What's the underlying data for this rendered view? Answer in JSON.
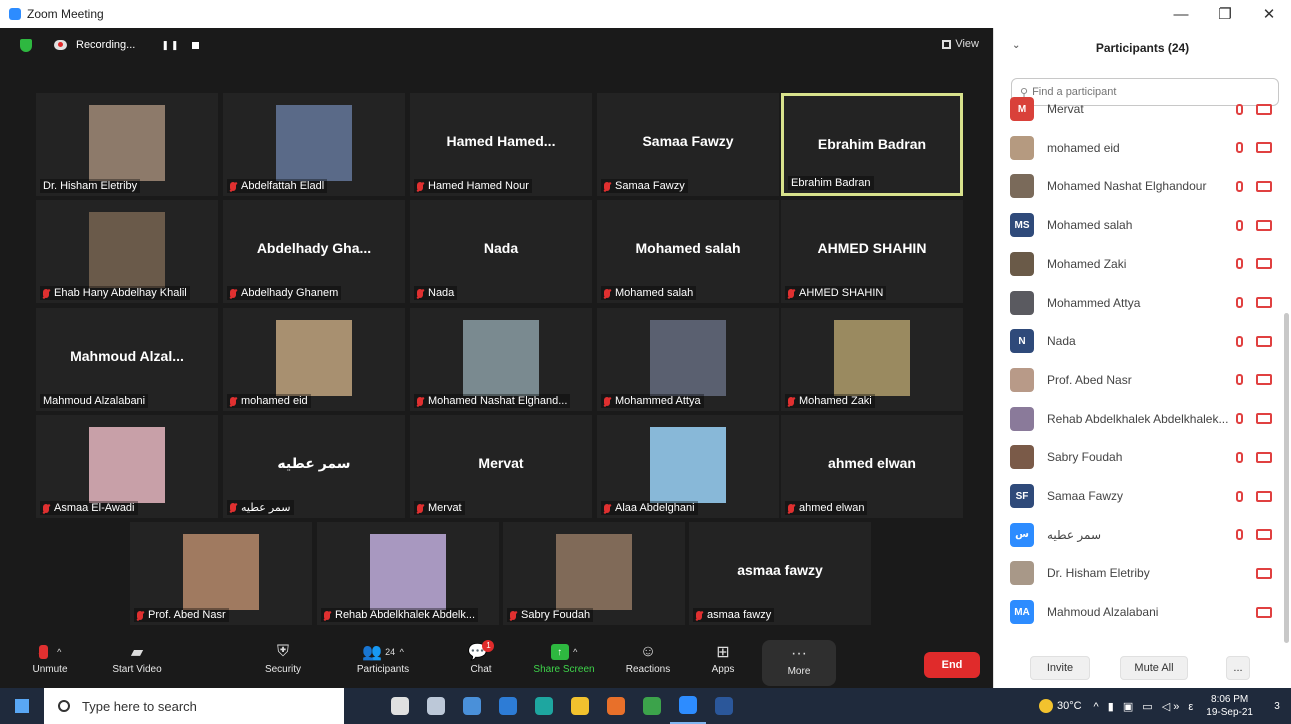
{
  "window": {
    "title": "Zoom Meeting",
    "min": "—",
    "max": "❐",
    "close": "✕"
  },
  "topbar": {
    "recording": "Recording...",
    "pause": "❚❚",
    "view": "View"
  },
  "gallery": [
    {
      "label": "Dr. Hisham Eletriby",
      "big": "",
      "photo": "#8d7a6a",
      "muted": false,
      "active": false
    },
    {
      "label": "Abdelfattah Eladl",
      "big": "",
      "photo": "#5a6a88",
      "muted": true,
      "active": false
    },
    {
      "label": "Hamed Hamed Nour",
      "big": "Hamed  Hamed...",
      "photo": "",
      "muted": true,
      "active": false
    },
    {
      "label": "Samaa Fawzy",
      "big": "Samaa Fawzy",
      "photo": "",
      "muted": true,
      "active": false
    },
    {
      "label": "Ebrahim Badran",
      "big": "Ebrahim Badran",
      "photo": "",
      "muted": false,
      "active": true
    },
    {
      "label": "Ehab Hany Abdelhay Khalil",
      "big": "",
      "photo": "#6a5a4a",
      "muted": true,
      "active": false
    },
    {
      "label": "Abdelhady Ghanem",
      "big": "Abdelhady  Gha...",
      "photo": "",
      "muted": true,
      "active": false
    },
    {
      "label": "Nada",
      "big": "Nada",
      "photo": "",
      "muted": true,
      "active": false
    },
    {
      "label": "Mohamed salah",
      "big": "Mohamed salah",
      "photo": "",
      "muted": true,
      "active": false
    },
    {
      "label": "AHMED SHAHIN",
      "big": "AHMED SHAHIN",
      "photo": "",
      "muted": true,
      "active": false
    },
    {
      "label": "Mahmoud Alzalabani",
      "big": "Mahmoud  Alzal...",
      "photo": "",
      "muted": false,
      "active": false
    },
    {
      "label": "mohamed eid",
      "big": "",
      "photo": "#a89070",
      "muted": true,
      "active": false
    },
    {
      "label": "Mohamed Nashat Elghand...",
      "big": "",
      "photo": "#7a8a90",
      "muted": true,
      "active": false
    },
    {
      "label": "Mohammed Attya",
      "big": "",
      "photo": "#5a6070",
      "muted": true,
      "active": false
    },
    {
      "label": "Mohamed Zaki",
      "big": "",
      "photo": "#9a8a60",
      "muted": true,
      "active": false
    },
    {
      "label": "Asmaa El-Awadi",
      "big": "",
      "photo": "#c8a0a8",
      "muted": true,
      "active": false
    },
    {
      "label": "سمر عطيه",
      "big": "سمر عطيه",
      "photo": "",
      "muted": true,
      "active": false
    },
    {
      "label": "Mervat",
      "big": "Mervat",
      "photo": "",
      "muted": true,
      "active": false
    },
    {
      "label": "Alaa Abdelghani",
      "big": "",
      "photo": "#88b8d8",
      "muted": true,
      "active": false
    },
    {
      "label": "ahmed elwan",
      "big": "ahmed elwan",
      "photo": "",
      "muted": true,
      "active": false
    },
    {
      "label": "Prof. Abed Nasr",
      "big": "",
      "photo": "#a07a60",
      "muted": true,
      "active": false
    },
    {
      "label": "Rehab Abdelkhalek Abdelk...",
      "big": "",
      "photo": "#a898c0",
      "muted": true,
      "active": false
    },
    {
      "label": "Sabry Foudah",
      "big": "",
      "photo": "#806a58",
      "muted": true,
      "active": false
    },
    {
      "label": "asmaa fawzy",
      "big": "asmaa fawzy",
      "photo": "",
      "muted": true,
      "active": false
    }
  ],
  "toolbar": {
    "unmute": "Unmute",
    "start_video": "Start Video",
    "security": "Security",
    "participants": "Participants",
    "participants_count": "24",
    "chat": "Chat",
    "chat_badge": "1",
    "share": "Share Screen",
    "reactions": "Reactions",
    "apps": "Apps",
    "more": "More",
    "end": "End"
  },
  "panel": {
    "title": "Participants (24)",
    "search_placeholder": "Find a participant",
    "invite": "Invite",
    "mute_all": "Mute All",
    "more": "...",
    "participants": [
      {
        "name": "Mervat",
        "initials": "M",
        "color": "#d9413a",
        "mic": true
      },
      {
        "name": "mohamed eid",
        "initials": "",
        "color": "#b59a80",
        "mic": true
      },
      {
        "name": "Mohamed Nashat Elghandour",
        "initials": "",
        "color": "#7a6a5a",
        "mic": true
      },
      {
        "name": "Mohamed salah",
        "initials": "MS",
        "color": "#2f4a7a",
        "mic": true
      },
      {
        "name": "Mohamed Zaki",
        "initials": "",
        "color": "#6a5a48",
        "mic": true
      },
      {
        "name": "Mohammed Attya",
        "initials": "",
        "color": "#5a5a60",
        "mic": true
      },
      {
        "name": "Nada",
        "initials": "N",
        "color": "#2f4a7a",
        "mic": true
      },
      {
        "name": "Prof. Abed Nasr",
        "initials": "",
        "color": "#b89a88",
        "mic": true
      },
      {
        "name": "Rehab Abdelkhalek Abdelkhalek...",
        "initials": "",
        "color": "#8a7a9a",
        "mic": true
      },
      {
        "name": "Sabry Foudah",
        "initials": "",
        "color": "#7a5a48",
        "mic": true
      },
      {
        "name": "Samaa Fawzy",
        "initials": "SF",
        "color": "#2f4a7a",
        "mic": true
      },
      {
        "name": "سمر عطيه",
        "initials": "س",
        "color": "#2d8cff",
        "mic": true
      },
      {
        "name": "Dr. Hisham Eletriby",
        "initials": "",
        "color": "#a89888",
        "mic": false
      },
      {
        "name": "Mahmoud Alzalabani",
        "initials": "MA",
        "color": "#2d8cff",
        "mic": false
      }
    ]
  },
  "taskbar": {
    "search_text": "Type here to search",
    "weather": "30°C",
    "tray_icons": "^ ▮ ▣ ▭ ◁» ε",
    "time": "8:06 PM",
    "date": "19-Sep-21",
    "notif": "3",
    "apps": [
      {
        "name": "task-view",
        "color": "#e0e0e0"
      },
      {
        "name": "widgets",
        "color": "#bcc8d8"
      },
      {
        "name": "store",
        "color": "#4a90d9"
      },
      {
        "name": "mail",
        "color": "#2d7cd6"
      },
      {
        "name": "edge",
        "color": "#1ea6a0"
      },
      {
        "name": "explorer",
        "color": "#f2c22e"
      },
      {
        "name": "firefox",
        "color": "#e8702a"
      },
      {
        "name": "chrome",
        "color": "#3ca34b"
      },
      {
        "name": "zoom",
        "color": "#2d8cff"
      },
      {
        "name": "word",
        "color": "#2b579a"
      }
    ]
  }
}
